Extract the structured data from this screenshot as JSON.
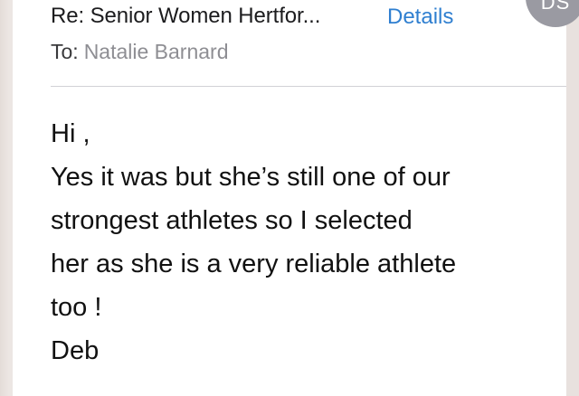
{
  "header": {
    "subject": "Re: Senior Women Hertfor...",
    "details_label": "Details",
    "avatar_initials": "DS",
    "to_label": "To:",
    "to_value": "Natalie Barnard"
  },
  "message": {
    "lines": [
      "Hi ,",
      "Yes it was but she’s still one of our",
      "strongest athletes so I selected",
      "her as she is a very reliable athlete",
      "too !",
      "Deb"
    ]
  }
}
